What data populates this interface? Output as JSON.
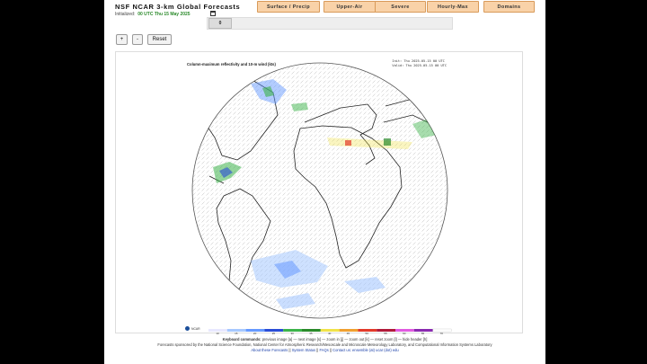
{
  "header": {
    "title": "NSF NCAR 3-km Global Forecasts",
    "initialized_label": "Initialized:",
    "initialized_value": "00 UTC Thu 15 May 2025"
  },
  "tabs": [
    {
      "label": "Surface / Precip"
    },
    {
      "label": "Upper-Air"
    },
    {
      "label": "Severe"
    },
    {
      "label": "Hourly-Max"
    },
    {
      "label": "Domains"
    }
  ],
  "slider": {
    "value": "0"
  },
  "zoom": {
    "plus": "+",
    "minus": "-",
    "reset": "Reset"
  },
  "plot": {
    "title": "Column-maximum reflectivity and 10-m wind (kts)",
    "init_line": "Init: Thu 2025-05-15 00 UTC",
    "valid_line": "Valid: Thu 2025-05-15 00 UTC",
    "logo_text": "NCAR",
    "colorbar_labels": [
      "10",
      "15",
      "20",
      "25",
      "30",
      "35",
      "40",
      "45",
      "50",
      "55",
      "60",
      "65",
      "70"
    ]
  },
  "footer": {
    "keyboard_prefix": "Keyboard commands:",
    "keyboard_text": " previous image [a] — next image [s] — zoom in [j] — zoom out [k] — reset zoom [l] — hide header [h]",
    "sponsor_text": "Forecasts sponsored by the National Science Foundation, National Center for Atmospheric Research/Mesoscale and Microscale Meteorology Laboratory, and Computational Information Systems Laboratory",
    "links": [
      "About these Forecasts",
      "System Status",
      "FAQs",
      "Contact us: ensemble (at) ucar (dot) edu"
    ],
    "separator": " || "
  },
  "colors": {
    "tab_bg": "#f9d2a8",
    "init_green": "#2a8a2a",
    "link_blue": "#1a3fa8"
  },
  "colorbar_colors": [
    "#e8e8ff",
    "#a6c8ff",
    "#6699ff",
    "#2a4dd6",
    "#3cb34a",
    "#2a8a2a",
    "#f0e24a",
    "#f0a030",
    "#e23a2a",
    "#b01a3a",
    "#e05ae0",
    "#8a2ab0",
    "#ffffff"
  ]
}
